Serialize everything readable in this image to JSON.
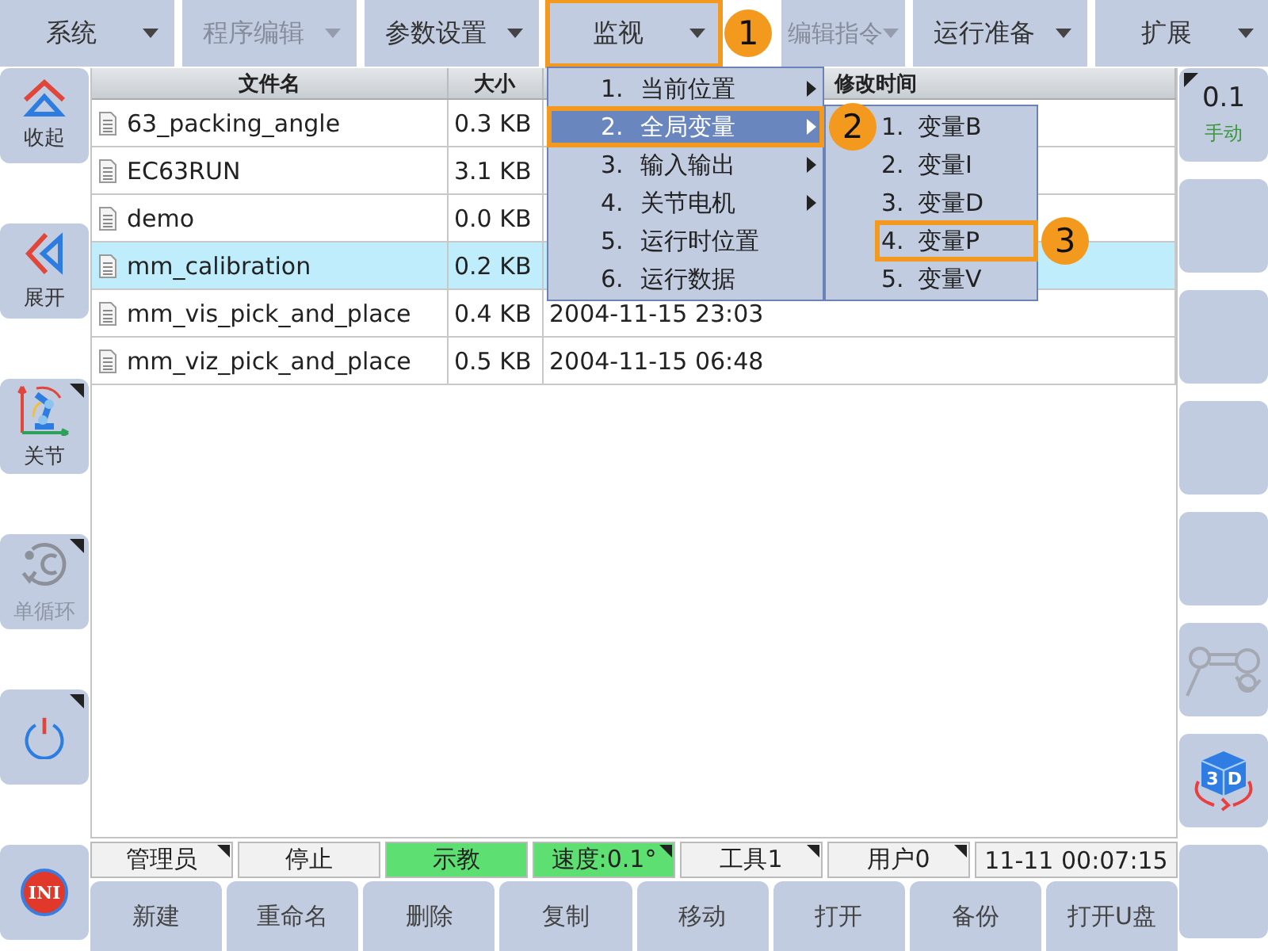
{
  "menu_bar": [
    {
      "label": "系统",
      "disabled": false
    },
    {
      "label": "程序编辑",
      "disabled": true
    },
    {
      "label": "参数设置",
      "disabled": false
    },
    {
      "label": "监视",
      "disabled": false,
      "callout": "1"
    },
    {
      "label": "编辑指令",
      "disabled": true
    },
    {
      "label": "运行准备",
      "disabled": false
    },
    {
      "label": "扩展",
      "disabled": false
    }
  ],
  "left_sidebar": [
    {
      "kind": "collapse",
      "label": "收起",
      "menu_mark": false,
      "disabled": false
    },
    {
      "kind": "expand",
      "label": "展开",
      "menu_mark": false,
      "disabled": false
    },
    {
      "kind": "joint",
      "label": "关节",
      "menu_mark": true,
      "disabled": false
    },
    {
      "kind": "cycle",
      "label": "单循环",
      "menu_mark": true,
      "disabled": true
    },
    {
      "kind": "power",
      "menu_mark": true,
      "disabled": false
    },
    {
      "kind": "ini",
      "icon_text": "INI",
      "menu_mark": false,
      "disabled": false
    }
  ],
  "file_table": {
    "columns": [
      "文件名",
      "大小",
      "修改时间"
    ],
    "rows": [
      {
        "name": "63_packing_angle",
        "size": "0.3 KB",
        "selected": false
      },
      {
        "name": "EC63RUN",
        "size": "3.1 KB",
        "selected": false
      },
      {
        "name": "demo",
        "size": "0.0 KB",
        "selected": false
      },
      {
        "name": "mm_calibration",
        "size": "0.2 KB",
        "selected": true
      },
      {
        "name": "mm_vis_pick_and_place",
        "size": "0.4 KB",
        "modified": "2004-11-15 23:03",
        "selected": false
      },
      {
        "name": "mm_viz_pick_and_place",
        "size": "0.5 KB",
        "modified": "2004-11-15 06:48",
        "selected": false
      }
    ]
  },
  "monitor_menu": {
    "items": [
      {
        "number": "1.",
        "label": "当前位置",
        "submenu": true,
        "selected": false
      },
      {
        "number": "2.",
        "label": "全局变量",
        "submenu": true,
        "selected": true,
        "callout": "2"
      },
      {
        "number": "3.",
        "label": "输入输出",
        "submenu": true,
        "selected": false
      },
      {
        "number": "4.",
        "label": "关节电机",
        "submenu": true,
        "selected": false
      },
      {
        "number": "5.",
        "label": "运行时位置",
        "submenu": false,
        "selected": false
      },
      {
        "number": "6.",
        "label": "运行数据",
        "submenu": false,
        "selected": false
      }
    ],
    "submenu": {
      "items": [
        {
          "number": "1.",
          "label": "变量B",
          "selected": false
        },
        {
          "number": "2.",
          "label": "变量I",
          "selected": false
        },
        {
          "number": "3.",
          "label": "变量D",
          "selected": false
        },
        {
          "number": "4.",
          "label": "变量P",
          "selected": false,
          "callout": "3"
        },
        {
          "number": "5.",
          "label": "变量V",
          "selected": false
        }
      ]
    }
  },
  "right_sidebar": [
    {
      "kind": "speed",
      "value": "0.1",
      "mode": "手动",
      "menu_mark": true
    },
    {
      "kind": "empty",
      "menu_mark": false
    },
    {
      "kind": "empty",
      "menu_mark": false
    },
    {
      "kind": "empty",
      "menu_mark": false
    },
    {
      "kind": "empty",
      "menu_mark": false
    },
    {
      "kind": "robot",
      "menu_mark": false
    },
    {
      "kind": "cube3d",
      "icon_text": [
        "3",
        "D"
      ],
      "menu_mark": false
    },
    {
      "kind": "empty",
      "menu_mark": false
    }
  ],
  "status_bar": [
    {
      "text": "管理员",
      "menu_mark": true,
      "active": false
    },
    {
      "text": "停止",
      "menu_mark": false,
      "active": false
    },
    {
      "text": "示教",
      "menu_mark": false,
      "active": true
    },
    {
      "text": "速度:0.1°",
      "menu_mark": true,
      "active": true
    },
    {
      "text": "工具1",
      "menu_mark": true,
      "active": false
    },
    {
      "text": "用户0",
      "menu_mark": true,
      "active": false
    },
    {
      "text": "11-11 00:07:15",
      "menu_mark": false,
      "active": false
    }
  ],
  "actions": [
    "新建",
    "重命名",
    "删除",
    "复制",
    "移动",
    "打开",
    "备份",
    "打开U盘"
  ]
}
